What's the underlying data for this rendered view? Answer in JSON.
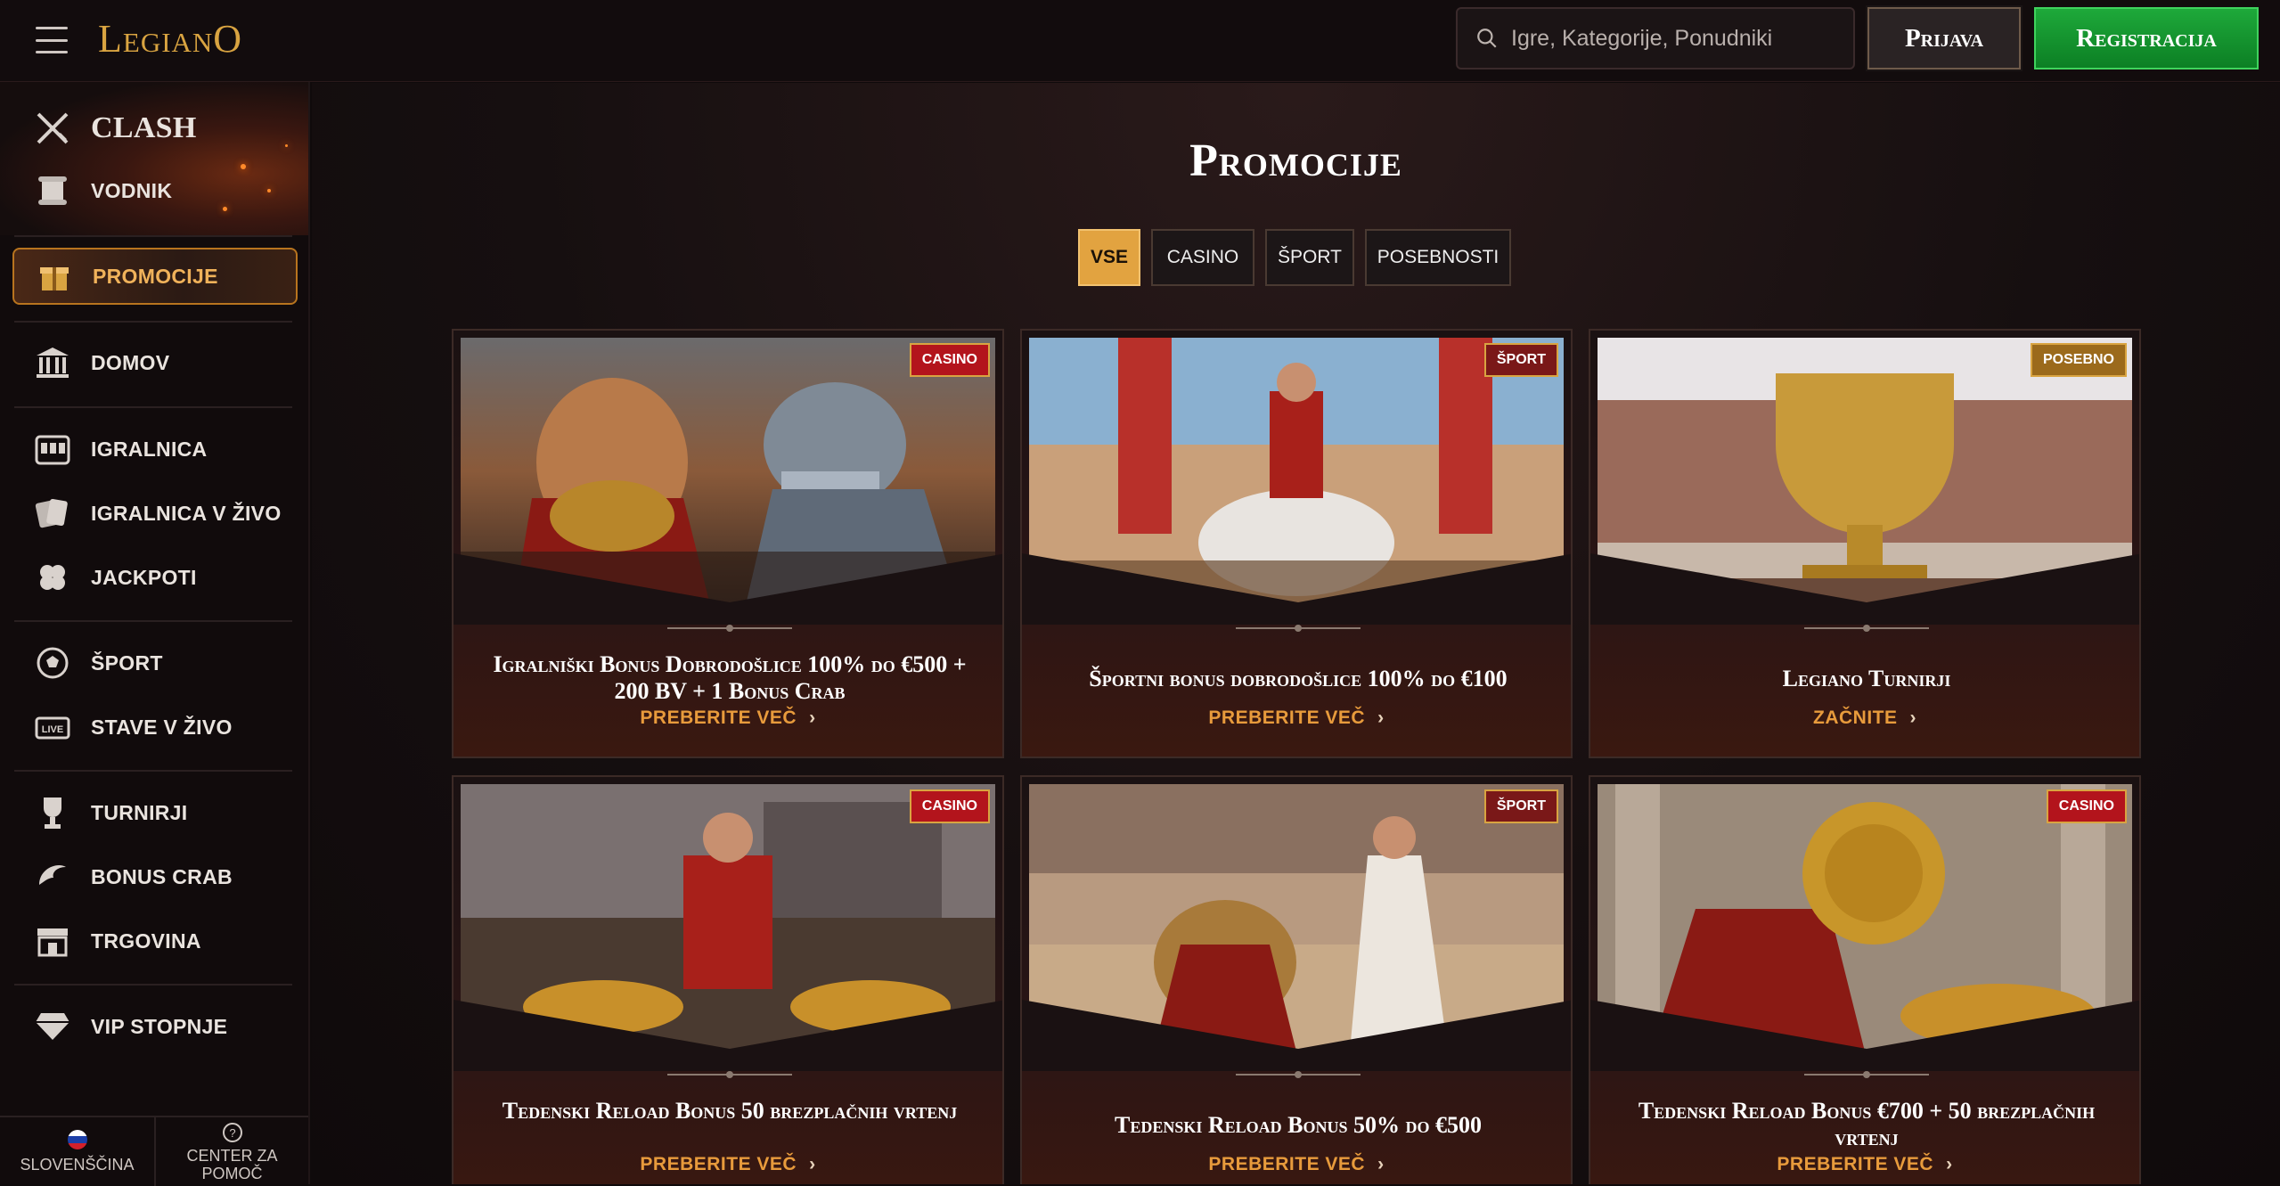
{
  "header": {
    "logo": "LegianO",
    "search_placeholder": "Igre, Kategorije, Ponudniki",
    "login_label": "Prijava",
    "register_label": "Registracija"
  },
  "sidebar": {
    "clash_label": "CLASH",
    "guide_label": "VODNIK",
    "items": [
      {
        "label": "PROMOCIJE",
        "icon": "gift-icon"
      },
      {
        "label": "DOMOV",
        "icon": "temple-icon"
      },
      {
        "label": "IGRALNICA",
        "icon": "slot-machine-icon"
      },
      {
        "label": "IGRALNICA V ŽIVO",
        "icon": "cards-icon"
      },
      {
        "label": "JACKPOTI",
        "icon": "clover-icon"
      },
      {
        "label": "ŠPORT",
        "icon": "ball-icon"
      },
      {
        "label": "STAVE V ŽIVO",
        "icon": "live-icon"
      },
      {
        "label": "TURNIRJI",
        "icon": "trophy-icon"
      },
      {
        "label": "BONUS CRAB",
        "icon": "claw-icon"
      },
      {
        "label": "TRGOVINA",
        "icon": "shop-icon"
      },
      {
        "label": "VIP STOPNJE",
        "icon": "diamond-icon"
      }
    ],
    "footer": {
      "language": "SLOVENŠČINA",
      "help": "CENTER ZA POMOČ"
    }
  },
  "main": {
    "title": "Promocije",
    "filters": [
      "VSE",
      "CASINO",
      "ŠPORT",
      "POSEBNOSTI"
    ],
    "active_filter": "VSE",
    "cards": [
      {
        "badge": "CASINO",
        "title": "Igralniški Bonus Dobrodošlice 100% do €500 + 200 BV + 1 Bonus Crab",
        "link": "PREBERITE VEČ"
      },
      {
        "badge": "ŠPORT",
        "title": "Športni bonus dobrodošlice 100% do €100",
        "link": "PREBERITE VEČ"
      },
      {
        "badge": "POSEBNO",
        "title": "Legiano Turnirji",
        "link": "ZAČNITE"
      },
      {
        "badge": "CASINO",
        "title": "Tedenski Reload Bonus 50 brezplačnih vrtenj",
        "link": "PREBERITE VEČ"
      },
      {
        "badge": "ŠPORT",
        "title": "Tedenski Reload Bonus 50% do €500",
        "link": "PREBERITE VEČ"
      },
      {
        "badge": "CASINO",
        "title": "Tedenski Reload Bonus €700 + 50 brezplačnih vrtenj",
        "link": "PREBERITE VEČ"
      }
    ]
  },
  "colors": {
    "accent_gold": "#e2a340",
    "register_green": "#16a034",
    "badge_red": "#b3141c",
    "link_orange": "#e89b3c"
  }
}
